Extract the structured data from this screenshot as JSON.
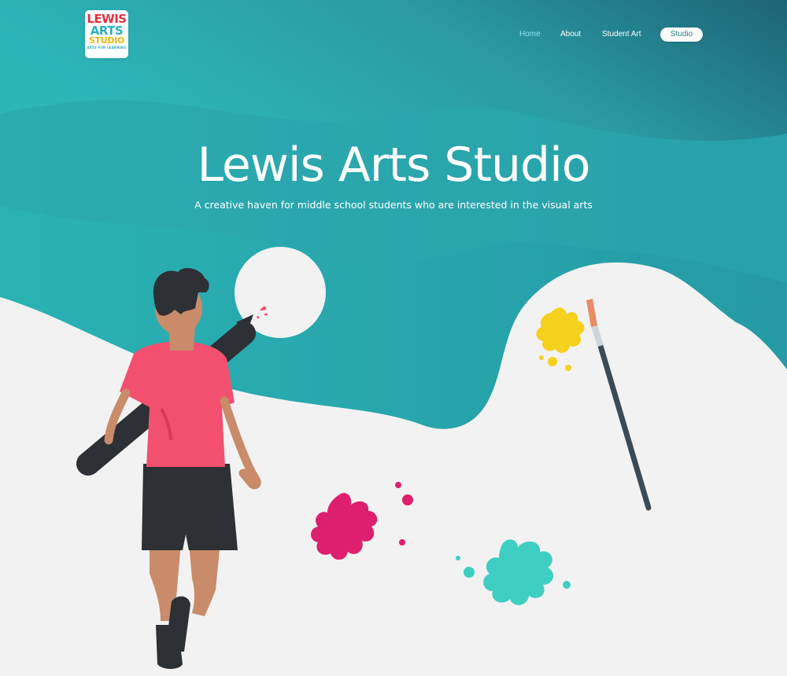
{
  "logo": {
    "line1": "LEWIS",
    "line2": "ARTS",
    "line3": "STUDIO",
    "tagline": "ARTS FOR LEARNING"
  },
  "nav": {
    "home": "Home",
    "about": "About",
    "student_art": "Student Art",
    "studio": "Studio",
    "active": "Home"
  },
  "hero": {
    "title": "Lewis Arts Studio",
    "subtitle": "A creative haven for middle school students who are interested in the visual arts"
  },
  "colors": {
    "teal": "#2bb0b4",
    "teal_dark": "#1f6f7c",
    "white": "#ffffff",
    "background": "#f2f2f2",
    "pink": "#f2506e",
    "magenta": "#de1f6d",
    "yellow": "#f5d01c",
    "aqua": "#3ecfc2",
    "charcoal": "#2a2e33"
  }
}
